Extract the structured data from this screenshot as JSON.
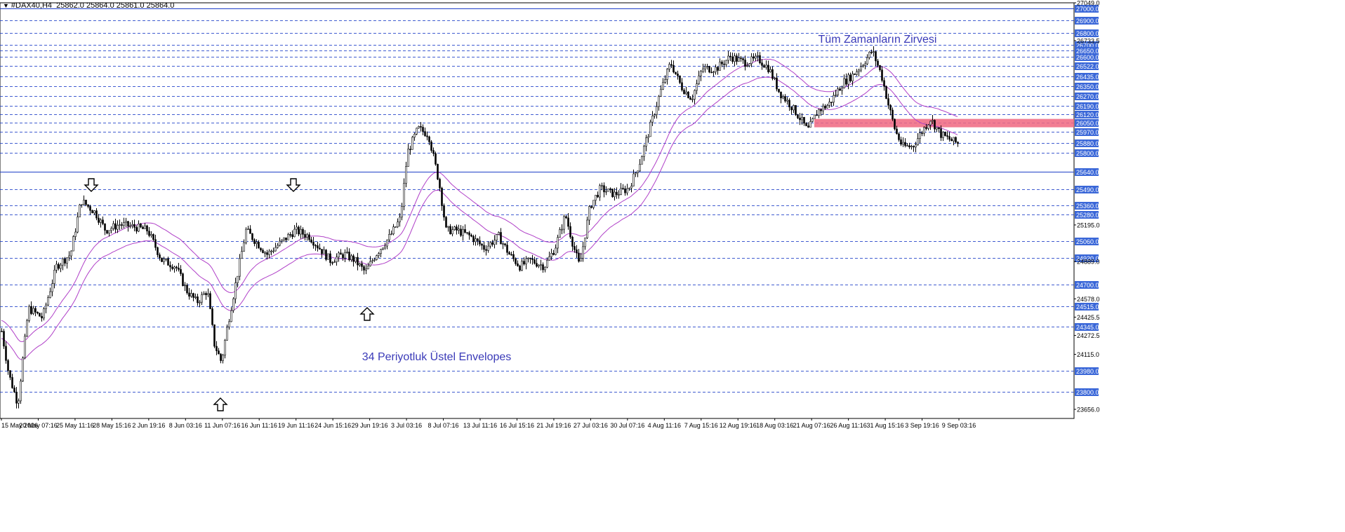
{
  "header": {
    "symbol": "#DAX40,H4",
    "ohlc": "25862.0 25864.0 25861.0 25864.0"
  },
  "annotations": {
    "all_time_high": "Tüm Zamanların Zirvesi",
    "envelopes_note": "34 Periyotluk Üstel Envelopes"
  },
  "colors": {
    "background": "#ffffff",
    "candle": "#000000",
    "level_line": "#1f3fc8",
    "level_tag": "#3a67d8",
    "envelope": "#b040c8",
    "resistance_zone": "#f06680",
    "annotation_text": "#3a3ab8",
    "arrow_icon": "#000000"
  },
  "icons": {
    "down_arrow": "hollow-down-arrow-icon",
    "up_arrow": "hollow-up-arrow-icon"
  },
  "chart_data": {
    "type": "candlestick",
    "ylim": [
      23580,
      27049
    ],
    "x_ticks": [
      "15 May 2026",
      "20 May 07:16",
      "25 May 11:16",
      "28 May 15:16",
      "2 Jun 19:16",
      "8 Jun 03:16",
      "11 Jun 07:16",
      "16 Jun 11:16",
      "19 Jun 11:16",
      "24 Jun 15:16",
      "29 Jun 19:16",
      "3 Jul 03:16",
      "8 Jul 07:16",
      "13 Jul 11:16",
      "16 Jul 15:16",
      "21 Jul 19:16",
      "27 Jul 03:16",
      "30 Jul 07:16",
      "4 Aug 11:16",
      "7 Aug 15:16",
      "12 Aug 19:16",
      "18 Aug 03:16",
      "21 Aug 07:16",
      "26 Aug 11:16",
      "31 Aug 15:16",
      "3 Sep 19:16",
      "9 Sep 03:16"
    ],
    "y_axis_scale_labels": [
      "27049.0",
      "26733.5",
      "25195.0",
      "24889.0",
      "24578.0",
      "24425.5",
      "24272.5",
      "24115.0",
      "23656.0"
    ],
    "horizontal_levels": [
      {
        "value": 27000.0,
        "label": "27000.0",
        "style": "solid"
      },
      {
        "value": 26900.0,
        "label": "26900.0",
        "style": "dashed"
      },
      {
        "value": 26800.0,
        "label": "26800.0",
        "style": "dashed"
      },
      {
        "value": 26700.0,
        "label": "26700.0",
        "style": "dashed"
      },
      {
        "value": 26650.0,
        "label": "26650.0",
        "style": "dashed"
      },
      {
        "value": 26600.0,
        "label": "26600.0",
        "style": "dashed"
      },
      {
        "value": 26522.0,
        "label": "26522.0",
        "style": "dashed"
      },
      {
        "value": 26435.0,
        "label": "26435.0",
        "style": "dashed"
      },
      {
        "value": 26350.0,
        "label": "26350.0",
        "style": "dashed"
      },
      {
        "value": 26270.0,
        "label": "26270.0",
        "style": "dashed"
      },
      {
        "value": 26190.0,
        "label": "26190.0",
        "style": "dashed"
      },
      {
        "value": 26120.0,
        "label": "26120.0",
        "style": "dashed"
      },
      {
        "value": 26050.0,
        "label": "26050.0",
        "style": "dashed"
      },
      {
        "value": 25970.0,
        "label": "25970.0",
        "style": "dashed"
      },
      {
        "value": 25880.0,
        "label": "25880.0",
        "style": "dashed"
      },
      {
        "value": 25800.0,
        "label": "25800.0",
        "style": "dashed"
      },
      {
        "value": 25640.0,
        "label": "25640.0",
        "style": "solid"
      },
      {
        "value": 25490.0,
        "label": "25490.0",
        "style": "dashed"
      },
      {
        "value": 25360.0,
        "label": "25360.0",
        "style": "dashed"
      },
      {
        "value": 25280.0,
        "label": "25280.0",
        "style": "dashed"
      },
      {
        "value": 25060.0,
        "label": "25060.0",
        "style": "dashed"
      },
      {
        "value": 24920.0,
        "label": "24920.0",
        "style": "dashed"
      },
      {
        "value": 24700.0,
        "label": "24700.0",
        "style": "dashed"
      },
      {
        "value": 24515.0,
        "label": "24515.0",
        "style": "dashed"
      },
      {
        "value": 24345.0,
        "label": "24345.0",
        "style": "dashed"
      },
      {
        "value": 23980.0,
        "label": "23980.0",
        "style": "dashed"
      },
      {
        "value": 23800.0,
        "label": "23800.0",
        "style": "dashed"
      }
    ],
    "resistance_zone": {
      "from": 26010,
      "to": 26080,
      "start_x_label": "21 Aug 07:16"
    },
    "price_path_anchors": [
      [
        0,
        24380
      ],
      [
        12,
        23950
      ],
      [
        25,
        23700
      ],
      [
        40,
        24500
      ],
      [
        60,
        24420
      ],
      [
        80,
        24850
      ],
      [
        100,
        24950
      ],
      [
        115,
        25400
      ],
      [
        135,
        25300
      ],
      [
        150,
        25150
      ],
      [
        170,
        25200
      ],
      [
        190,
        25180
      ],
      [
        210,
        25150
      ],
      [
        230,
        24900
      ],
      [
        250,
        24850
      ],
      [
        265,
        24650
      ],
      [
        280,
        24550
      ],
      [
        295,
        24650
      ],
      [
        305,
        24200
      ],
      [
        315,
        24050
      ],
      [
        322,
        24300
      ],
      [
        335,
        24700
      ],
      [
        350,
        25150
      ],
      [
        365,
        25050
      ],
      [
        380,
        24950
      ],
      [
        400,
        25050
      ],
      [
        420,
        25150
      ],
      [
        440,
        25100
      ],
      [
        455,
        25000
      ],
      [
        470,
        24900
      ],
      [
        490,
        24950
      ],
      [
        505,
        24900
      ],
      [
        520,
        24800
      ],
      [
        535,
        24950
      ],
      [
        555,
        25100
      ],
      [
        570,
        25250
      ],
      [
        580,
        25800
      ],
      [
        595,
        26000
      ],
      [
        610,
        25950
      ],
      [
        625,
        25550
      ],
      [
        635,
        25150
      ],
      [
        650,
        25150
      ],
      [
        670,
        25100
      ],
      [
        690,
        25000
      ],
      [
        710,
        25100
      ],
      [
        725,
        24950
      ],
      [
        740,
        24850
      ],
      [
        755,
        24900
      ],
      [
        775,
        24850
      ],
      [
        790,
        25000
      ],
      [
        805,
        25280
      ],
      [
        815,
        25050
      ],
      [
        825,
        24850
      ],
      [
        840,
        25350
      ],
      [
        855,
        25500
      ],
      [
        875,
        25450
      ],
      [
        895,
        25500
      ],
      [
        910,
        25700
      ],
      [
        925,
        26000
      ],
      [
        940,
        26300
      ],
      [
        955,
        26550
      ],
      [
        970,
        26350
      ],
      [
        985,
        26250
      ],
      [
        1000,
        26500
      ],
      [
        1020,
        26500
      ],
      [
        1040,
        26600
      ],
      [
        1060,
        26550
      ],
      [
        1080,
        26580
      ],
      [
        1095,
        26500
      ],
      [
        1110,
        26300
      ],
      [
        1125,
        26200
      ],
      [
        1140,
        26080
      ],
      [
        1150,
        25980
      ],
      [
        1165,
        26150
      ],
      [
        1180,
        26200
      ],
      [
        1200,
        26380
      ],
      [
        1215,
        26450
      ],
      [
        1230,
        26550
      ],
      [
        1242,
        26650
      ],
      [
        1255,
        26450
      ],
      [
        1265,
        26200
      ],
      [
        1275,
        25980
      ],
      [
        1285,
        25850
      ],
      [
        1300,
        25850
      ],
      [
        1310,
        25950
      ],
      [
        1325,
        26080
      ],
      [
        1340,
        25950
      ],
      [
        1355,
        25900
      ],
      [
        1366,
        25870
      ]
    ]
  }
}
